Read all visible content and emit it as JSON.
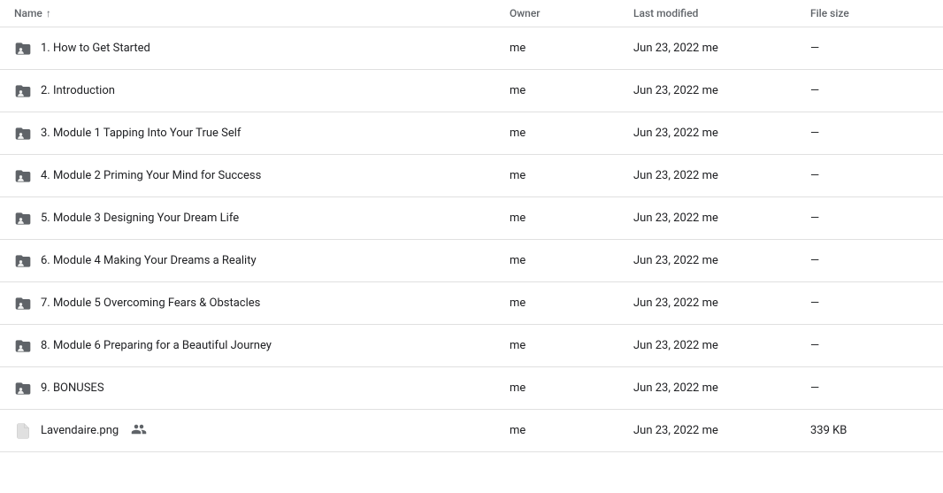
{
  "header": {
    "col_name": "Name",
    "col_owner": "Owner",
    "col_modified": "Last modified",
    "col_size": "File size",
    "sort_arrow": "↑"
  },
  "rows": [
    {
      "number": "1.",
      "name": "How to Get Started",
      "type": "folder",
      "shared": false,
      "owner": "me",
      "modified": "Jun 23, 2022 me",
      "size": "—"
    },
    {
      "number": "2.",
      "name": "Introduction",
      "type": "folder",
      "shared": false,
      "owner": "me",
      "modified": "Jun 23, 2022 me",
      "size": "—"
    },
    {
      "number": "3.",
      "name": "Module 1 Tapping Into Your True Self",
      "type": "folder",
      "shared": false,
      "owner": "me",
      "modified": "Jun 23, 2022 me",
      "size": "—"
    },
    {
      "number": "4.",
      "name": "Module 2 Priming Your Mind for Success",
      "type": "folder",
      "shared": false,
      "owner": "me",
      "modified": "Jun 23, 2022 me",
      "size": "—"
    },
    {
      "number": "5.",
      "name": "Module 3 Designing Your Dream Life",
      "type": "folder",
      "shared": false,
      "owner": "me",
      "modified": "Jun 23, 2022 me",
      "size": "—"
    },
    {
      "number": "6.",
      "name": "Module 4 Making Your Dreams a Reality",
      "type": "folder",
      "shared": false,
      "owner": "me",
      "modified": "Jun 23, 2022 me",
      "size": "—"
    },
    {
      "number": "7.",
      "name": "Module 5 Overcoming Fears & Obstacles",
      "type": "folder",
      "shared": false,
      "owner": "me",
      "modified": "Jun 23, 2022 me",
      "size": "—"
    },
    {
      "number": "8.",
      "name": "Module 6 Preparing for a Beautiful Journey",
      "type": "folder",
      "shared": false,
      "owner": "me",
      "modified": "Jun 23, 2022 me",
      "size": "—"
    },
    {
      "number": "9.",
      "name": "BONUSES",
      "type": "folder",
      "shared": false,
      "owner": "me",
      "modified": "Jun 23, 2022 me",
      "size": "—"
    },
    {
      "number": "",
      "name": "Lavendaire.png",
      "type": "file",
      "shared": true,
      "owner": "me",
      "modified": "Jun 23, 2022 me",
      "size": "339 KB"
    }
  ]
}
